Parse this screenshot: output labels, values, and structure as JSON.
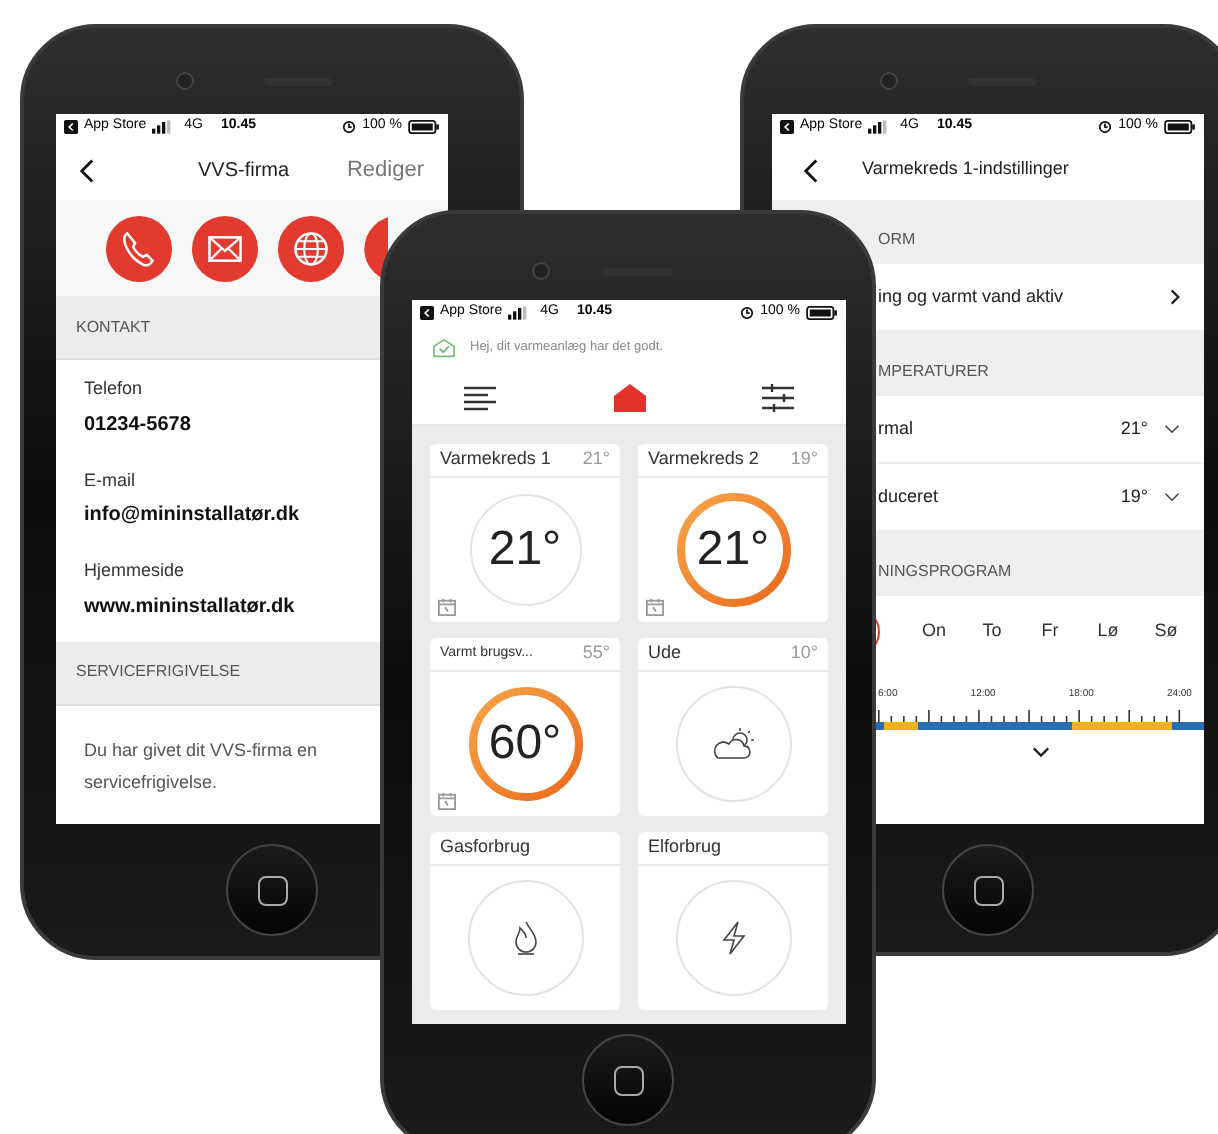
{
  "contact_screen": {
    "status_bar": {
      "carrier": "App Store",
      "network": "4G",
      "time": "10.45",
      "battery": "100 %"
    },
    "title": "VVS-firma",
    "action": "Rediger",
    "contact_buttons": [
      {
        "kind": "phone"
      },
      {
        "kind": "mail"
      },
      {
        "kind": "web"
      },
      {
        "kind": "other"
      }
    ],
    "sections": [
      {
        "title": "KONTAKT",
        "fields": [
          {
            "label": "Telefon",
            "value": "01234-5678"
          },
          {
            "label": "E-mail",
            "value": "info@mininstallatør.dk"
          },
          {
            "label": "Hjemmeside",
            "value": "www.mininstallatør.dk"
          }
        ]
      },
      {
        "title": "SERVICEFRIGIVELSE",
        "text": "Du har givet dit VVS-firma en servicefrigivelse."
      }
    ]
  },
  "home_screen": {
    "status_bar": {
      "carrier": "App Store",
      "network": "4G",
      "time": "10.45",
      "battery": "100 %"
    },
    "greeting": "Hej, dit varmeanlæg har det godt.",
    "nav": [
      {
        "kind": "menu",
        "selected": false
      },
      {
        "kind": "home",
        "selected": true
      },
      {
        "kind": "sliders",
        "selected": false
      }
    ],
    "tiles": [
      {
        "kind": "dial",
        "title": "Varmekreds 1",
        "reading": "21°",
        "value": "21°",
        "active": false,
        "schedule": true
      },
      {
        "kind": "dial",
        "title": "Varmekreds 2",
        "reading": "19°",
        "value": "21°",
        "active": true,
        "schedule": true
      },
      {
        "kind": "dial",
        "title": "Varmt brugsv...",
        "reading": "55°",
        "value": "60°",
        "active": true,
        "schedule": true
      },
      {
        "kind": "weather",
        "title": "Ude",
        "reading": "10°"
      },
      {
        "kind": "gas",
        "title": "Gasforbrug"
      },
      {
        "kind": "power",
        "title": "Elforbrug"
      }
    ]
  },
  "settings_screen": {
    "status_bar": {
      "carrier": "App Store",
      "network": "4G",
      "time": "10.45",
      "battery": "100 %"
    },
    "title": "Varmekreds 1-indstillinger",
    "sections": [
      {
        "title": "ORM",
        "rows": [
          {
            "kind": "link",
            "label": "ing og varmt vand aktiv"
          }
        ]
      },
      {
        "title": "MPERATURER",
        "rows": [
          {
            "kind": "dropdown",
            "label": "rmal",
            "value": "21°"
          },
          {
            "kind": "dropdown",
            "label": "duceret",
            "value": "19°"
          }
        ]
      },
      {
        "title": "NINGSPROGRAM",
        "days": [
          {
            "label": "On",
            "selected": false
          },
          {
            "label": "To",
            "selected": false
          },
          {
            "label": "Fr",
            "selected": false
          },
          {
            "label": "Lø",
            "selected": false
          },
          {
            "label": "Sø",
            "selected": false
          }
        ],
        "time_labels": [
          "6:00",
          "12:00",
          "18:00",
          "24:00"
        ]
      }
    ]
  }
}
